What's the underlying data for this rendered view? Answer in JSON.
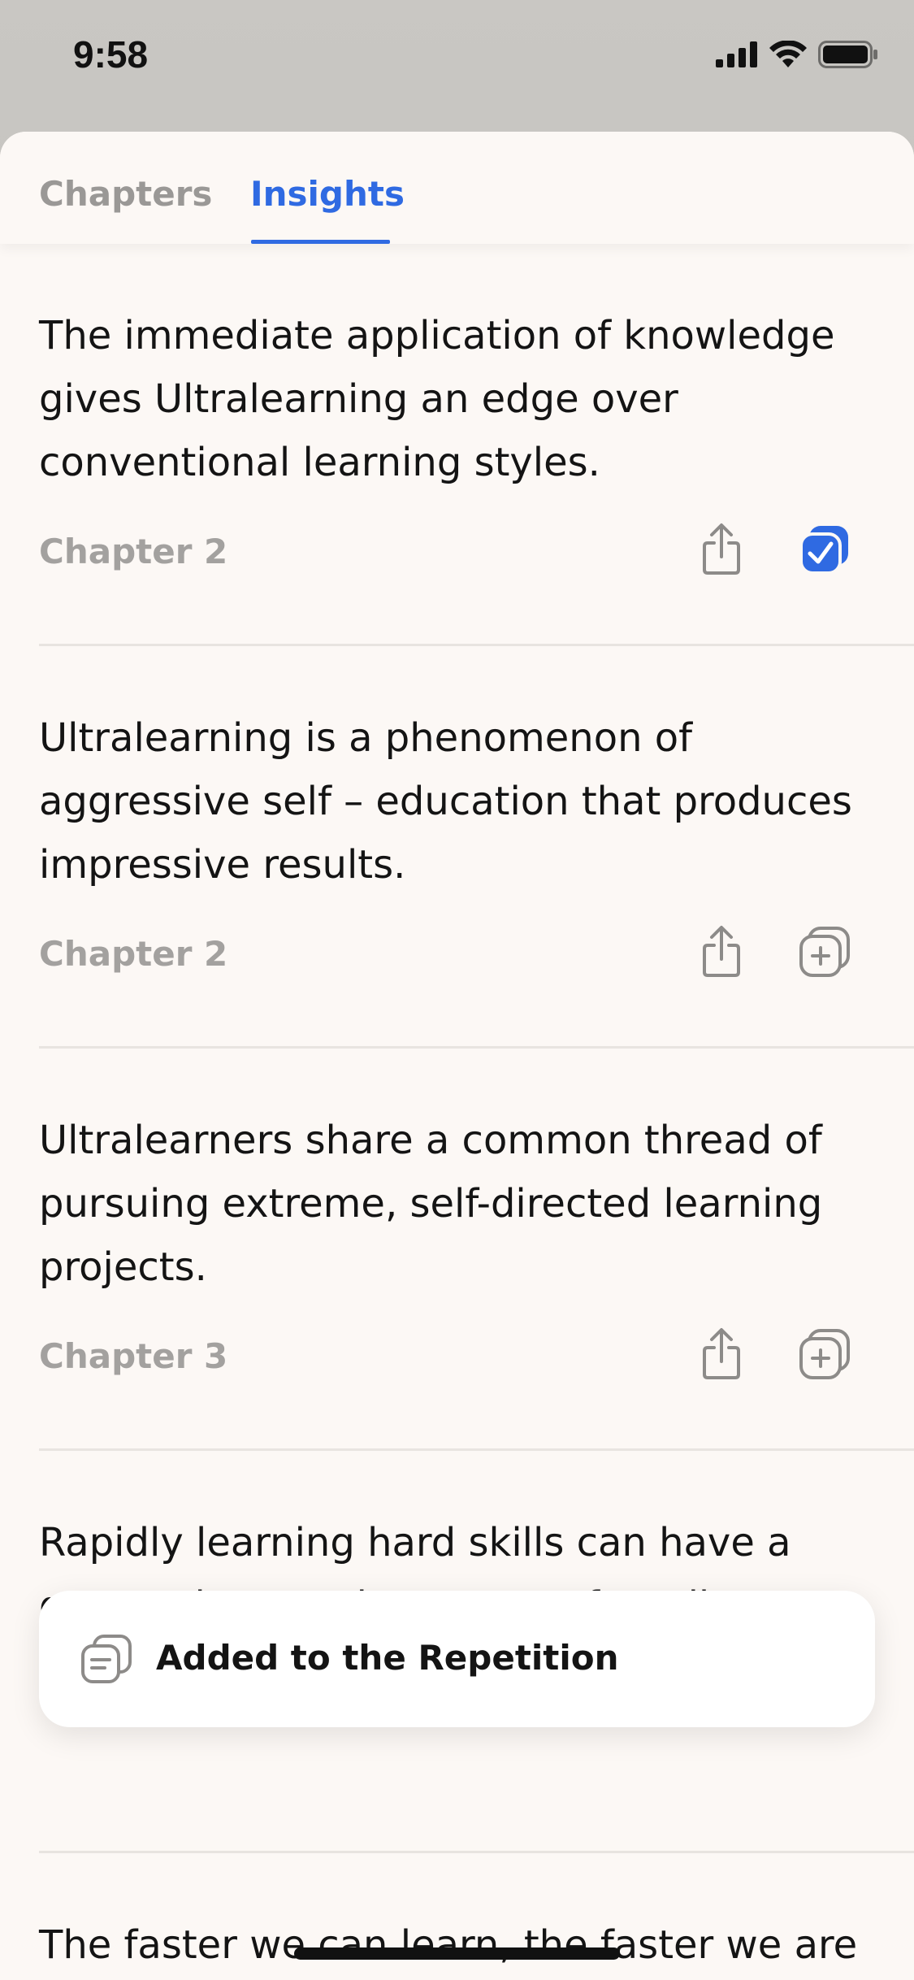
{
  "status_bar": {
    "time": "9:58"
  },
  "tabs": [
    {
      "label": "Chapters",
      "active": false
    },
    {
      "label": "Insights",
      "active": true
    }
  ],
  "insights": [
    {
      "text": "The immediate application of knowledge gives Ultralearning an edge over conventional learning styles.",
      "chapter": "Chapter 2",
      "added": true
    },
    {
      "text": "Ultralearning is a phenomenon of aggressive self – education that produces impressive results.",
      "chapter": "Chapter 2",
      "added": false
    },
    {
      "text": "Ultralearners share a common thread of pursuing extreme, self-directed learning projects.",
      "chapter": "Chapter 3",
      "added": false
    },
    {
      "text": "Rapidly learning hard skills can have a greater impact than years of mediocre striving on the job.",
      "chapter": "",
      "added": false
    },
    {
      "text": "The faster we can learn, the faster we are",
      "chapter": "",
      "added": false
    }
  ],
  "toast": {
    "message": "Added to the Repetition",
    "icon": "cards-icon"
  },
  "colors": {
    "accent": "#2f6ae2",
    "muted": "#a3a19f",
    "background": "#fcf8f5"
  }
}
